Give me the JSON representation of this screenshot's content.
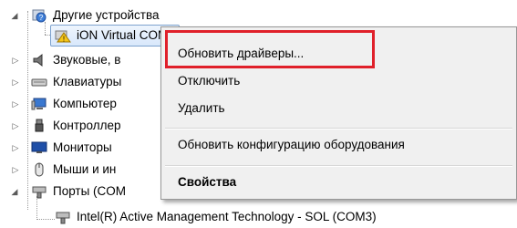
{
  "tree": {
    "items": [
      {
        "label": "Другие устройства",
        "icon": "unknown-device-folder-icon",
        "expanded": true
      },
      {
        "label": "iON Virtual COM",
        "icon": "warning-device-icon",
        "selected": true
      },
      {
        "label": "Звуковые, в",
        "icon": "speaker-icon"
      },
      {
        "label": "Клавиатуры",
        "icon": "keyboard-icon"
      },
      {
        "label": "Компьютер",
        "icon": "computer-icon"
      },
      {
        "label": "Контроллер",
        "icon": "usb-controller-icon"
      },
      {
        "label": "Мониторы",
        "icon": "monitor-icon"
      },
      {
        "label": "Мыши и ин",
        "icon": "mouse-icon"
      },
      {
        "label": "Порты (COM",
        "icon": "port-icon",
        "expanded": true
      },
      {
        "label": "Intel(R) Active Management Technology - SOL (COM3)",
        "icon": "port-icon"
      }
    ]
  },
  "context_menu": {
    "items": [
      {
        "label": "Обновить драйверы..."
      },
      {
        "label": "Отключить"
      },
      {
        "label": "Удалить"
      },
      {
        "label": "Обновить конфигурацию оборудования"
      },
      {
        "label": "Свойства",
        "bold": true
      }
    ]
  },
  "colors": {
    "highlight_border": "#e0202a",
    "menu_background": "#f0f0f0",
    "selection": "#d9e8fb"
  }
}
